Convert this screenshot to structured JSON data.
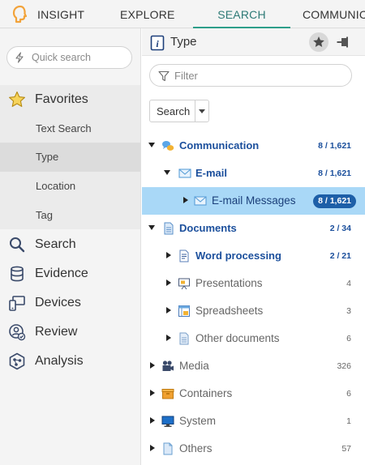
{
  "tabs": {
    "insight": "INSIGHT",
    "explore": "EXPLORE",
    "search": "SEARCH",
    "communication": "COMMUNIC"
  },
  "sidebar": {
    "quick_search_placeholder": "Quick search",
    "favorites": "Favorites",
    "favorites_items": [
      "Text Search",
      "Type",
      "Location",
      "Tag"
    ],
    "nav": [
      "Search",
      "Evidence",
      "Devices",
      "Review",
      "Analysis"
    ]
  },
  "panel": {
    "title": "Type",
    "filter_placeholder": "Filter",
    "mode_label": "Search"
  },
  "tree": [
    {
      "label": "Communication",
      "count": "8 / 1,621"
    },
    {
      "label": "E-mail",
      "count": "8 / 1,621"
    },
    {
      "label": "E-mail Messages",
      "count": "8 / 1,621"
    },
    {
      "label": "Documents",
      "count": "2 / 34"
    },
    {
      "label": "Word processing",
      "count": "2 / 21"
    },
    {
      "label": "Presentations",
      "count": "4"
    },
    {
      "label": "Spreadsheets",
      "count": "3"
    },
    {
      "label": "Other documents",
      "count": "6"
    },
    {
      "label": "Media",
      "count": "326"
    },
    {
      "label": "Containers",
      "count": "6"
    },
    {
      "label": "System",
      "count": "1"
    },
    {
      "label": "Others",
      "count": "57"
    }
  ],
  "colors": {
    "accent": "#2d9e8a",
    "link": "#1b4f9c",
    "selected_row": "#a9d8f7",
    "badge": "#1d5fa8"
  }
}
